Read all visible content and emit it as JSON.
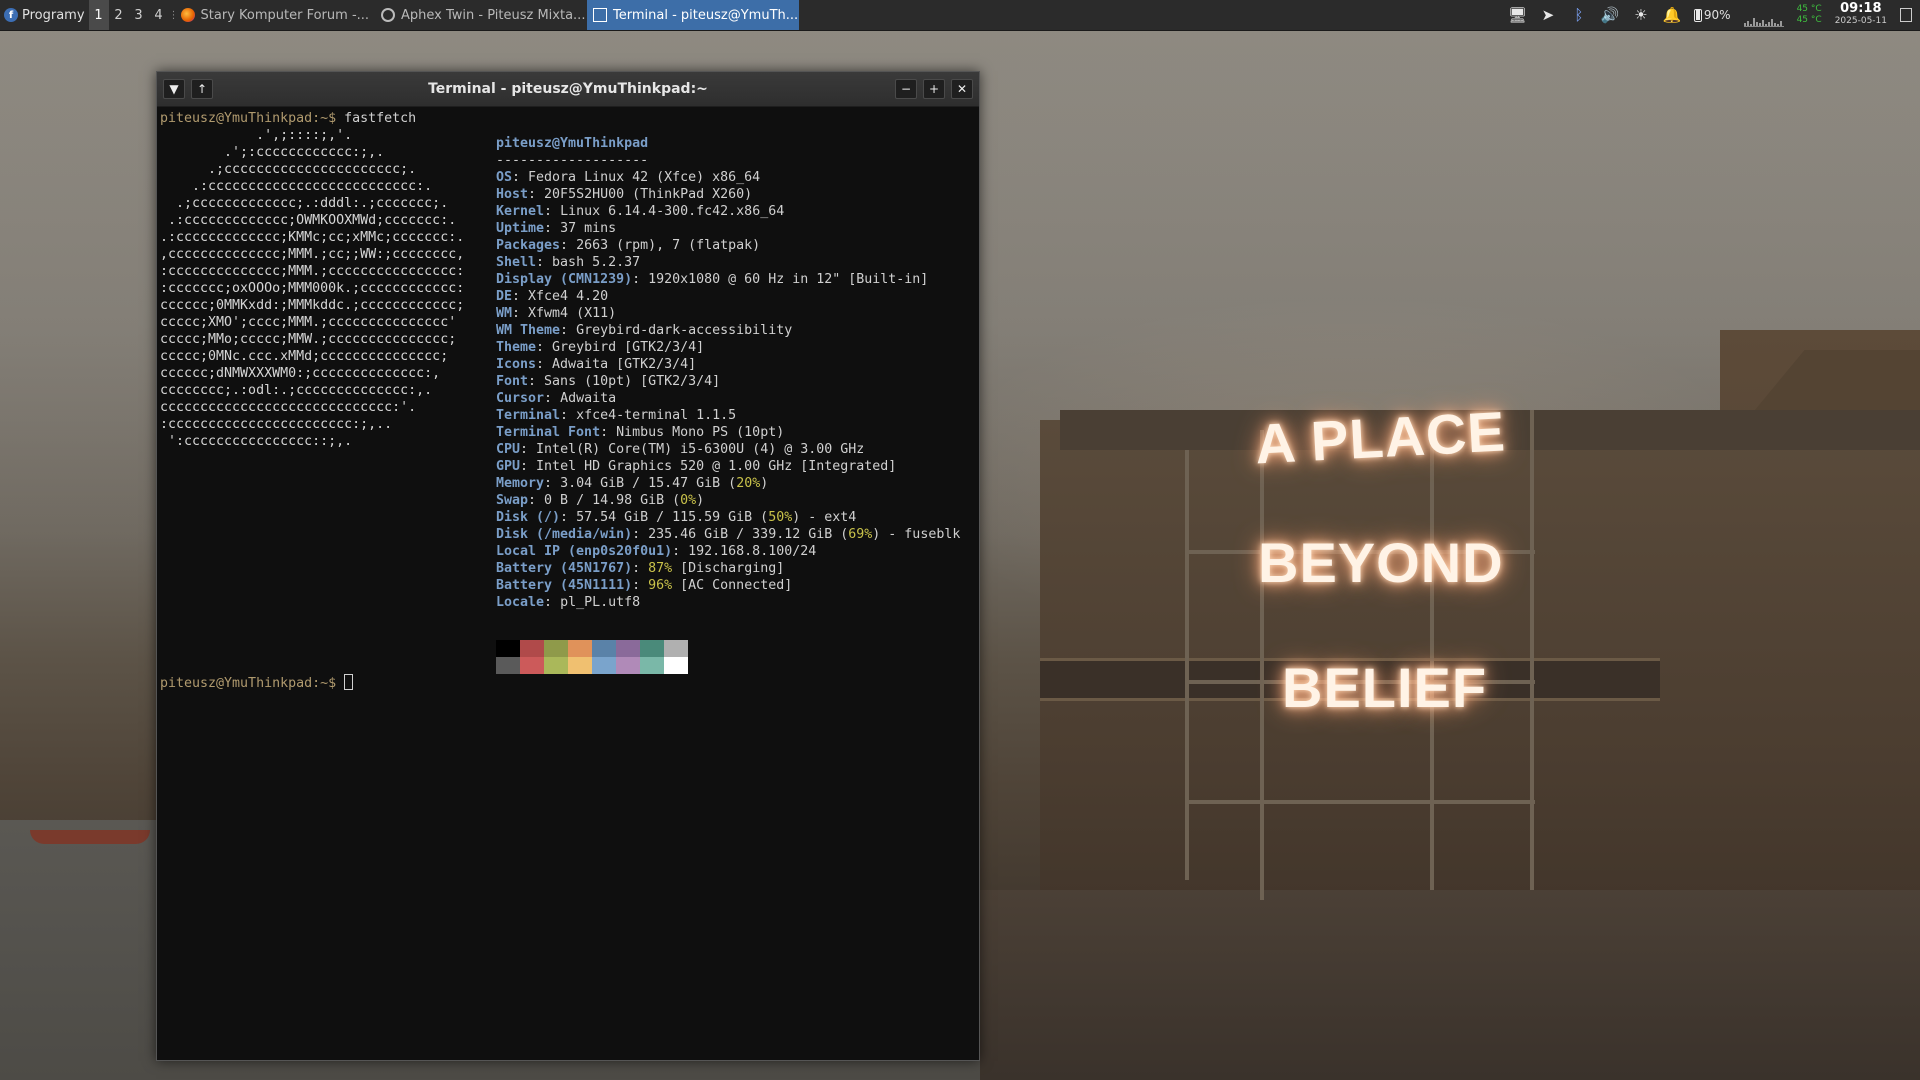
{
  "panel": {
    "apps_label": "Programy",
    "workspaces": [
      "1",
      "2",
      "3",
      "4"
    ],
    "tasks": [
      {
        "label": "Stary Komputer Forum -...",
        "icon": "firefox-icon"
      },
      {
        "label": "Aphex Twin - Piteusz Mixta...",
        "icon": "media-player-icon"
      },
      {
        "label": "Terminal - piteusz@YmuTh...",
        "icon": "terminal-icon"
      }
    ],
    "tray": {
      "battery_percent": "90%",
      "battery_level": 0.9,
      "temp_1": "45 °C",
      "temp_2": "45 °C",
      "time": "09:18",
      "date": "2025-05-11"
    }
  },
  "terminal": {
    "title": "Terminal - piteusz@YmuThinkpad:~",
    "prompt": "piteusz@YmuThinkpad:~$",
    "command": " fastfetch",
    "logo_lines": [
      "            .',;::::;,'.",
      "        .';:cccccccccccc:;,.",
      "      .;cccccccccccccccccccccc;.",
      "    .:cccccccccccccccccccccccccc:.",
      "  .;ccccccccccccc;.:dddl:.;ccccccc;.",
      " .:ccccccccccccc;OWMKOOXMWd;ccccccc:.",
      ".:ccccccccccccc;KMMc;cc;xMMc;ccccccc:.",
      ",cccccccccccccc;MMM.;cc;;WW:;cccccccc,",
      ":cccccccccccccc;MMM.;cccccccccccccccc:",
      ":ccccccc;oxOOOo;MMM000k.;cccccccccccc:",
      "cccccc;0MMKxdd:;MMMkddc.;cccccccccccc;",
      "ccccc;XMO';cccc;MMM.;ccccccccccccccc'",
      "ccccc;MMo;ccccc;MMW.;ccccccccccccccc;",
      "ccccc;0MNc.ccc.xMMd;ccccccccccccccc;",
      "cccccc;dNMWXXXWM0:;cccccccccccccc:,",
      "cccccccc;.:odl:.;cccccccccccccc:,.",
      "ccccccccccccccccccccccccccccc:'.",
      ":ccccccccccccccccccccccc:;,..",
      " ':cccccccccccccccc::;,."
    ],
    "user_host": "piteusz@YmuThinkpad",
    "separator": "-------------------",
    "info": [
      {
        "key": "OS",
        "value": "Fedora Linux 42 (Xfce) x86_64"
      },
      {
        "key": "Host",
        "value": "20F5S2HU00 (ThinkPad X260)"
      },
      {
        "key": "Kernel",
        "value": "Linux 6.14.4-300.fc42.x86_64"
      },
      {
        "key": "Uptime",
        "value": "37 mins"
      },
      {
        "key": "Packages",
        "value": "2663 (rpm), 7 (flatpak)"
      },
      {
        "key": "Shell",
        "value": "bash 5.2.37"
      },
      {
        "key": "Display (CMN1239)",
        "value": "1920x1080 @ 60 Hz in 12\" [Built-in]"
      },
      {
        "key": "DE",
        "value": "Xfce4 4.20"
      },
      {
        "key": "WM",
        "value": "Xfwm4 (X11)"
      },
      {
        "key": "WM Theme",
        "value": "Greybird-dark-accessibility"
      },
      {
        "key": "Theme",
        "value": "Greybird [GTK2/3/4]"
      },
      {
        "key": "Icons",
        "value": "Adwaita [GTK2/3/4]"
      },
      {
        "key": "Font",
        "value": "Sans (10pt) [GTK2/3/4]"
      },
      {
        "key": "Cursor",
        "value": "Adwaita"
      },
      {
        "key": "Terminal",
        "value": "xfce4-terminal 1.1.5"
      },
      {
        "key": "Terminal Font",
        "value": "Nimbus Mono PS (10pt)"
      },
      {
        "key": "CPU",
        "value": "Intel(R) Core(TM) i5-6300U (4) @ 3.00 GHz"
      },
      {
        "key": "GPU",
        "value": "Intel HD Graphics 520 @ 1.00 GHz [Integrated]"
      },
      {
        "key": "Memory",
        "value": "3.04 GiB / 15.47 GiB (",
        "pct": "20%",
        "tail": ")"
      },
      {
        "key": "Swap",
        "value": "0 B / 14.98 GiB (",
        "pct": "0%",
        "tail": ")"
      },
      {
        "key": "Disk (/)",
        "value": "57.54 GiB / 115.59 GiB (",
        "pct": "50%",
        "tail": ") - ext4"
      },
      {
        "key": "Disk (/media/win)",
        "value": "235.46 GiB / 339.12 GiB (",
        "pct": "69%",
        "tail": ") - fuseblk"
      },
      {
        "key": "Local IP (enp0s20f0u1)",
        "value": "192.168.8.100/24"
      },
      {
        "key": "Battery (45N1767)",
        "value": "",
        "pct": "87%",
        "tail": " [Discharging]"
      },
      {
        "key": "Battery (45N1111)",
        "value": "",
        "pct": "96%",
        "tail": " [AC Connected]"
      },
      {
        "key": "Locale",
        "value": "pl_PL.utf8"
      }
    ],
    "palette_top": [
      "#000000",
      "#b04a4a",
      "#8f9a4a",
      "#e0925a",
      "#5a82a8",
      "#8a6a9a",
      "#4a8a7a",
      "#b0b0b0"
    ],
    "palette_bottom": [
      "#5a5a5a",
      "#cc5a5a",
      "#aab85a",
      "#f0c070",
      "#7aa4cc",
      "#b08ab8",
      "#7ab8a8",
      "#ffffff"
    ]
  },
  "wallpaper": {
    "neon_lines": [
      "A PLACE",
      "BEYOND",
      "BELIEF"
    ]
  }
}
